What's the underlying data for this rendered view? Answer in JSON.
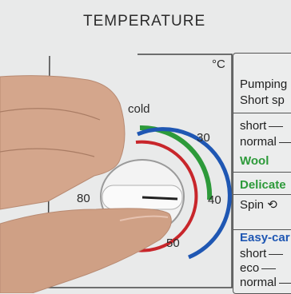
{
  "header": {
    "title": "TEMPERATURE"
  },
  "dial": {
    "unit": "°C",
    "labels": {
      "cold": "cold",
      "t30": "30",
      "t40": "40",
      "t50": "50",
      "t80": "80"
    }
  },
  "programs": {
    "pumping": "Pumping",
    "short_spin": "Short sp",
    "short": "short",
    "normal": "normal",
    "wool": "Wool",
    "delicate": "Delicate",
    "spin": "Spin",
    "easy_care": "Easy-car",
    "short2": "short",
    "eco": "eco",
    "normal2": "normal"
  },
  "colors": {
    "panel_bg": "#e9eaea",
    "ring_green": "#2d9a3a",
    "ring_blue": "#1f57b3",
    "ring_red": "#c8262b",
    "skin": "#d4a68c"
  },
  "icons": {
    "spin": "spin-icon"
  }
}
